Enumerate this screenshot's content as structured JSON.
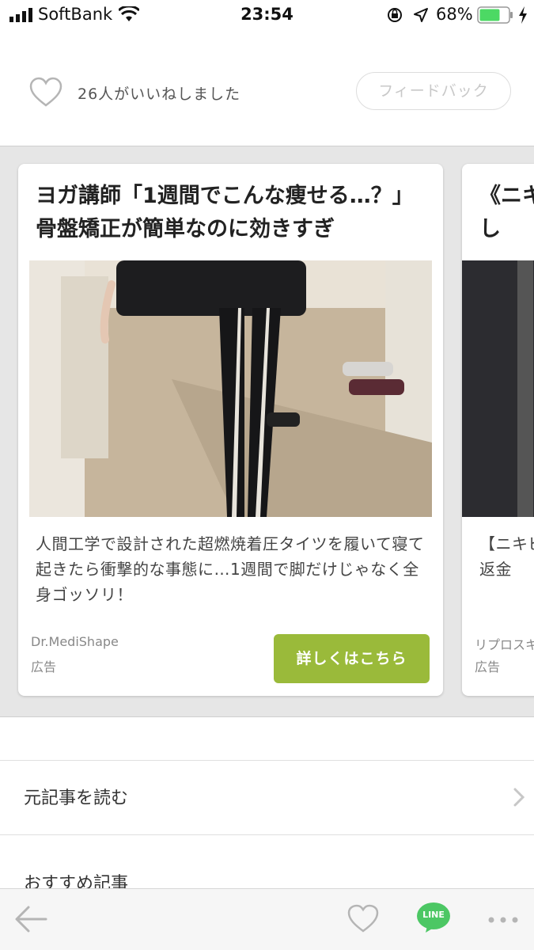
{
  "status_bar": {
    "carrier": "SoftBank",
    "time": "23:54",
    "battery_pct": "68%"
  },
  "like_row": {
    "count_text": "26人がいいねしました",
    "feedback_label": "フィードバック"
  },
  "ad_cards": [
    {
      "title": "ヨガ講師「1週間でこんな痩せる…？」骨盤矯正が簡単なのに効きすぎ",
      "body": "人間工学で設計された超燃焼着圧タイツを履いて寝て起きたら衝撃的な事態に…1週間で脚だけじゃなく全身ゴッソリ！",
      "sponsor": "Dr.MediShape",
      "ad_label": "広告",
      "cta": "詳しくはこちら"
    },
    {
      "title": "《ニキビ苦悩し",
      "body": "【ニキビコレ使の返金",
      "sponsor": "リプロスキ",
      "ad_label": "広告"
    }
  ],
  "links": {
    "read_original": "元記事を読む",
    "recommended": "おすすめ記事"
  },
  "bottom_bar": {
    "line_label": "LINE"
  },
  "colors": {
    "accent_green": "#9aba3a",
    "line_green": "#4cc764",
    "icon_gray": "#b5b5b5",
    "text_dark": "#222222",
    "text_gray": "#777777"
  }
}
